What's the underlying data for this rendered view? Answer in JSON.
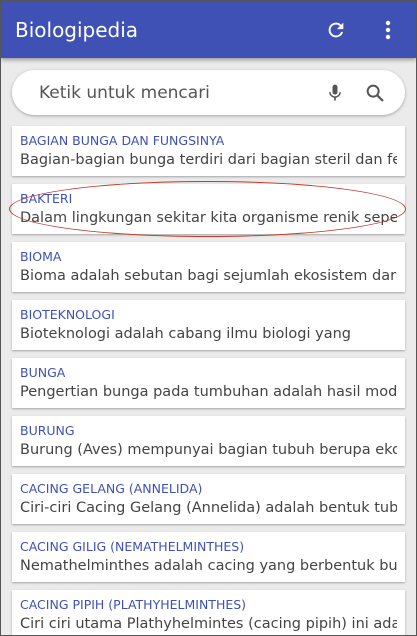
{
  "app": {
    "title": "Biologipedia",
    "accent_color": "#3f51b5",
    "actions": [
      {
        "name": "refresh",
        "icon": "refresh-icon"
      },
      {
        "name": "more",
        "icon": "more-vert-icon"
      }
    ]
  },
  "search": {
    "placeholder": "Ketik untuk mencari",
    "value": "",
    "icons": [
      "mic-icon",
      "search-icon"
    ]
  },
  "items": [
    {
      "title": "BAGIAN BUNGA DAN FUNGSINYA",
      "desc": "Bagian-bagian bunga terdiri dari bagian steril dan fertil."
    },
    {
      "title": "BAKTERI",
      "desc": "Dalam lingkungan sekitar kita organisme renik seperti"
    },
    {
      "title": "BIOMA",
      "desc": "Bioma adalah sebutan bagi sejumlah ekosistem darat"
    },
    {
      "title": "BIOTEKNOLOGI",
      "desc": "Bioteknologi adalah cabang ilmu biologi yang"
    },
    {
      "title": "BUNGA",
      "desc": "Pengertian bunga pada tumbuhan adalah hasil modifikasi"
    },
    {
      "title": "BURUNG",
      "desc": "Burung (Aves) mempunyai bagian tubuh berupa ekor,"
    },
    {
      "title": "CACING GELANG (ANNELIDA)",
      "desc": "Ciri-ciri Cacing Gelang (Annelida) adalah bentuk tubuh"
    },
    {
      "title": "CACING GILIG (NEMATHELMINTHES)",
      "desc": "Nemathelminthes adalah cacing yang berbentuk bulat"
    },
    {
      "title": "CACING PIPIH (PLATHYHELMINTHES)",
      "desc": "Ciri ciri utama Plathyhelmintes (cacing pipih) ini adalah"
    }
  ],
  "highlight": {
    "item_title": "BAKTERI",
    "color": "#c0392b"
  }
}
